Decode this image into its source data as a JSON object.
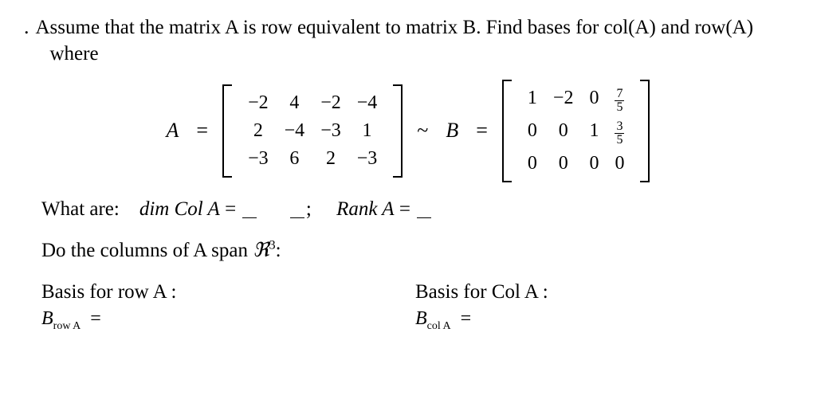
{
  "problem": {
    "number": ".",
    "intro": "Assume that the matrix A is row equivalent to matrix B. Find bases for col(A) and row(A)",
    "where": "where"
  },
  "matrices": {
    "A_label": "A",
    "A_eq": "=",
    "A": [
      [
        "−2",
        "4",
        "−2",
        "−4"
      ],
      [
        "2",
        "−4",
        "−3",
        "1"
      ],
      [
        "−3",
        "6",
        "2",
        "−3"
      ]
    ],
    "tilde": "~",
    "B_label": "B",
    "B_eq": "=",
    "B": [
      [
        "1",
        "−2",
        "0",
        {
          "frac": [
            "7",
            "5"
          ]
        }
      ],
      [
        "0",
        "0",
        "1",
        {
          "frac": [
            "3",
            "5"
          ]
        }
      ],
      [
        "0",
        "0",
        "0",
        "0"
      ]
    ]
  },
  "questions": {
    "what_are": "What are:",
    "dim_col": "dim Col A",
    "eq1": "=",
    "semi": ";",
    "rank": "Rank A",
    "eq2": "=",
    "span_q": "Do the columns of  A  span  ",
    "R3": "ℜ",
    "R3_sup": "3",
    "colon": ":"
  },
  "basis": {
    "row_title": "Basis for row A :",
    "row_B": "B",
    "row_sub": "row A",
    "row_eq": "=",
    "col_title": "Basis for Col A :",
    "col_B": "B",
    "col_sub": "col A",
    "col_eq": "="
  }
}
